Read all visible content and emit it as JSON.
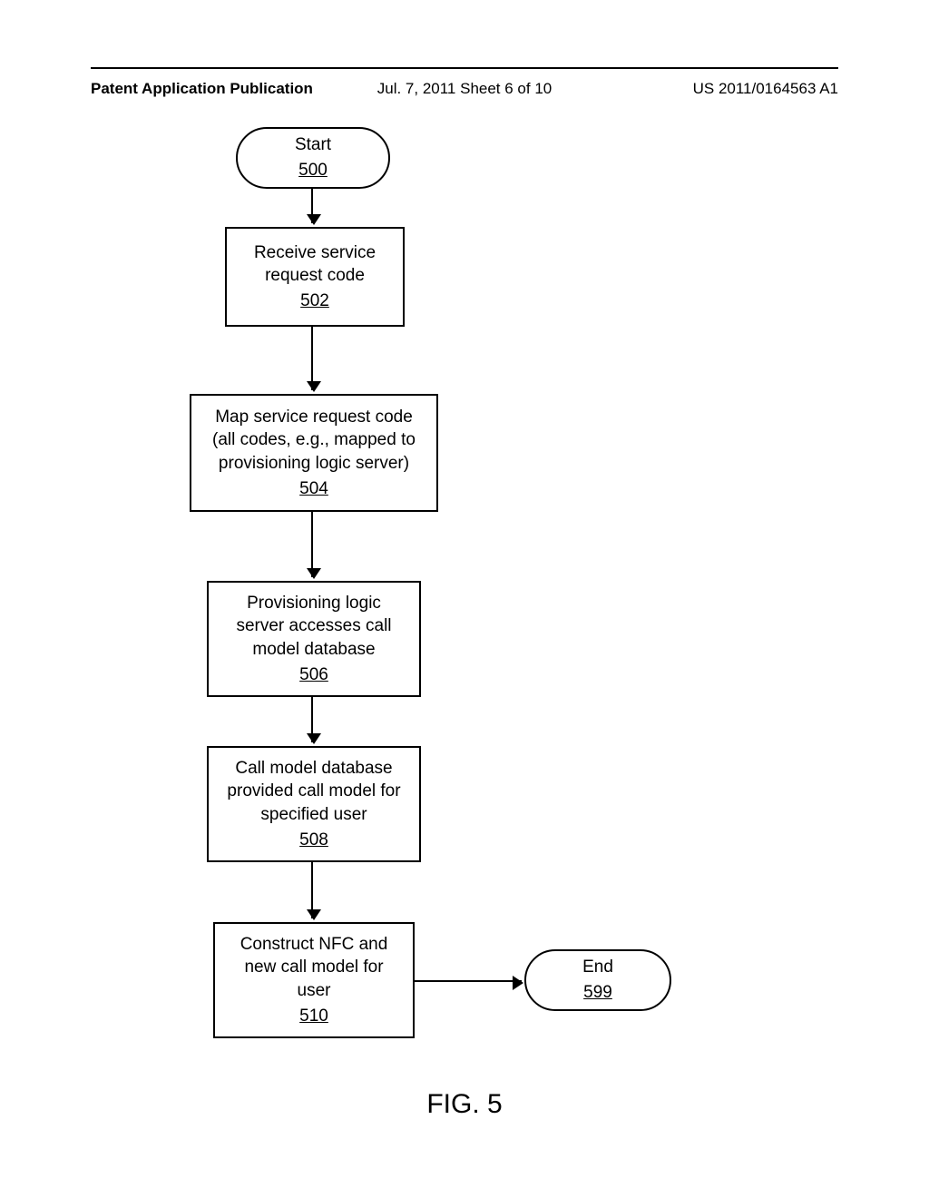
{
  "header": {
    "left": "Patent Application Publication",
    "center": "Jul. 7, 2011   Sheet 6 of 10",
    "right": "US 2011/0164563 A1"
  },
  "flow": {
    "start": {
      "label": "Start",
      "ref": "500"
    },
    "step1": {
      "label": "Receive service request code",
      "ref": "502"
    },
    "step2": {
      "label": "Map service request code (all codes, e.g., mapped to provisioning logic server)",
      "ref": "504"
    },
    "step3": {
      "label": "Provisioning logic server accesses call model database",
      "ref": "506"
    },
    "step4": {
      "label": "Call model database provided call model for specified user",
      "ref": "508"
    },
    "step5": {
      "label": "Construct NFC and new call model for user",
      "ref": "510"
    },
    "end": {
      "label": "End",
      "ref": "599"
    }
  },
  "figure_caption": "FIG. 5"
}
